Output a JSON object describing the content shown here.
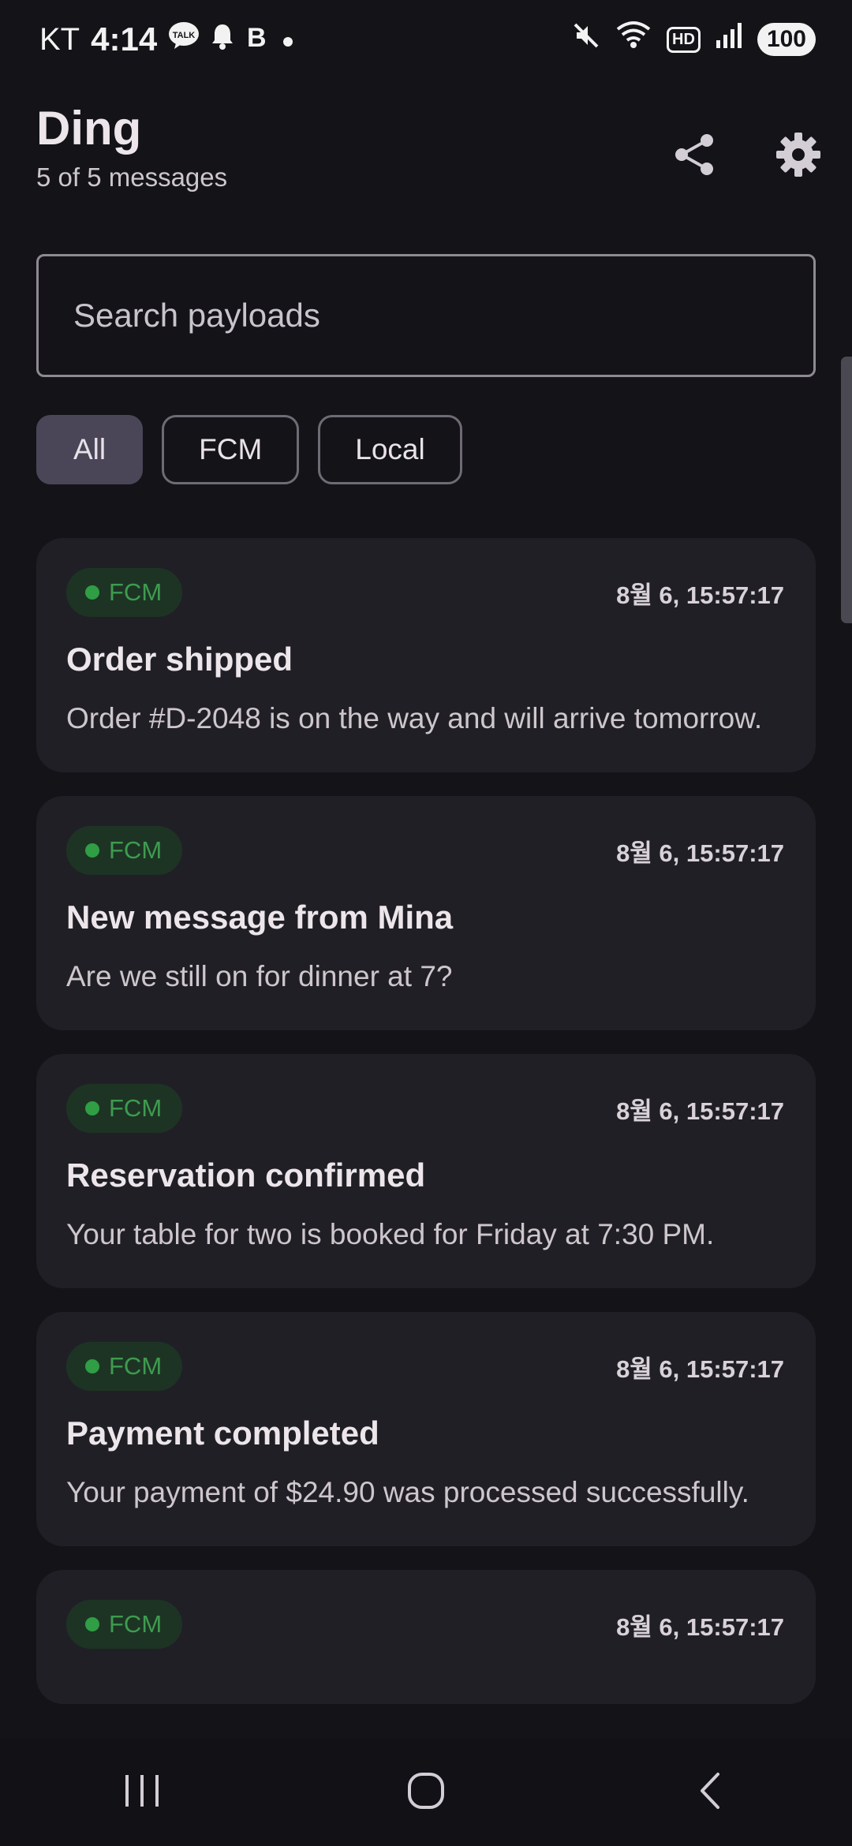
{
  "status_bar": {
    "carrier": "KT",
    "time": "4:14",
    "left_icons": [
      "talk-icon",
      "bell-icon",
      "b-icon",
      "dot-icon"
    ],
    "right_icons": [
      "mute-icon",
      "wifi-icon",
      "hd-icon",
      "signal-icon"
    ],
    "hd_label": "HD",
    "battery": "100"
  },
  "header": {
    "title": "Ding",
    "subtitle": "5 of 5 messages",
    "share_icon": "share-icon",
    "settings_icon": "gear-icon"
  },
  "search": {
    "placeholder": "Search payloads",
    "value": ""
  },
  "filters": [
    {
      "label": "All",
      "selected": true
    },
    {
      "label": "FCM",
      "selected": false
    },
    {
      "label": "Local",
      "selected": false
    }
  ],
  "messages": [
    {
      "source": "FCM",
      "timestamp": "8월 6, 15:57:17",
      "title": "Order shipped",
      "body": "Order #D-2048 is on the way and will arrive tomorrow."
    },
    {
      "source": "FCM",
      "timestamp": "8월 6, 15:57:17",
      "title": "New message from Mina",
      "body": "Are we still on for dinner at 7?"
    },
    {
      "source": "FCM",
      "timestamp": "8월 6, 15:57:17",
      "title": "Reservation confirmed",
      "body": "Your table for two is booked for Friday at 7:30 PM."
    },
    {
      "source": "FCM",
      "timestamp": "8월 6, 15:57:17",
      "title": "Payment completed",
      "body": "Your payment of $24.90 was processed successfully."
    },
    {
      "source": "FCM",
      "timestamp": "8월 6, 15:57:17",
      "title": "",
      "body": ""
    }
  ],
  "colors": {
    "background": "#141318",
    "card": "#211f26",
    "fcm_green": "#2f9e44",
    "chip_selected": "#4a4658"
  },
  "nav_bar": {
    "icons": [
      "recents-icon",
      "home-icon",
      "back-icon"
    ]
  }
}
